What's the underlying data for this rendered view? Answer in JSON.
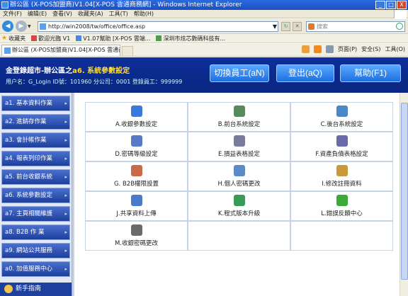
{
  "window": {
    "title": "辦公區 (X-POS加盟商)V1.04[X-POS 雲通商務網] - Windows Internet Explorer",
    "min": "_",
    "max": "□",
    "close": "X"
  },
  "menu": [
    "文件(F)",
    "编辑(E)",
    "查看(V)",
    "收藏夹(A)",
    "工具(T)",
    "帮助(H)"
  ],
  "address": {
    "url": "http://win2008/tw/office/office.asp",
    "search_placeholder": "搜索"
  },
  "favorites": {
    "label": "收藏夹",
    "items": [
      "歡迎光臨 V1",
      "V1.07幫助 [X-POS 雲端...",
      "深圳市炫芯數碼科技有..."
    ]
  },
  "tab": {
    "title": "辦公區 (X-POS加盟商)V1.04[X-POS 雲通商務網]"
  },
  "commands": [
    "页面(P)",
    "安全(S)",
    "工具(O)"
  ],
  "header": {
    "title_prefix": "金登錄超市-辦公區之",
    "title_highlight": "a6. 系統參數設定",
    "user_line": "用户名：G_Login ID號：101960 分公司：0001  登錄員工：999999",
    "switch_label": "切換員工(aN)",
    "logout_label": "登出(aQ)",
    "help_label": "幫助(F1)"
  },
  "sidebar": {
    "items": [
      "a1. 基本資料作業",
      "a2. 進銷存作業",
      "a3. 會計帳作業",
      "a4. 報表列印作業",
      "a5. 前台收銀系統",
      "a6. 系統參數設定",
      "a7. 主頁相關維護",
      "a8. B2B 作 業",
      "a9. 網站公共服務",
      "a0. 加值服務中心"
    ],
    "guide": "新手指南"
  },
  "grid": [
    {
      "label": "A.收銀參數設定",
      "icon": "globe-settings-icon",
      "color": "#3a7ad8"
    },
    {
      "label": "B.前台系統設定",
      "icon": "monitor-wrench-icon",
      "color": "#5a8a5a"
    },
    {
      "label": "C.後台系統設定",
      "icon": "server-icon",
      "color": "#4a88c8"
    },
    {
      "label": "D.密碼等級設定",
      "icon": "password-lock-icon",
      "color": "#5a78c8"
    },
    {
      "label": "E.損益表格設定",
      "icon": "spreadsheet-icon",
      "color": "#7a7a9a"
    },
    {
      "label": "F.資產負債表格設定",
      "icon": "balance-sheet-icon",
      "color": "#6a6aa8"
    },
    {
      "label": "G. B2B權限設置",
      "icon": "permission-icon",
      "color": "#c86a4a"
    },
    {
      "label": "H.個人密碼更改",
      "icon": "user-key-icon",
      "color": "#5a8ac8"
    },
    {
      "label": "I.修改註冊資料",
      "icon": "pen-icon",
      "color": "#c89a3a"
    },
    {
      "label": "J.共享資料上傳",
      "icon": "share-upload-icon",
      "color": "#4a7ac8"
    },
    {
      "label": "K.程式版本升級",
      "icon": "document-upgrade-icon",
      "color": "#3a9a5a"
    },
    {
      "label": "L.錯誤反饋中心",
      "icon": "feedback-icon",
      "color": "#3aaa3a"
    },
    {
      "label": "M.收銀密碼更改",
      "icon": "cash-register-icon",
      "color": "#6a6a6a"
    }
  ]
}
